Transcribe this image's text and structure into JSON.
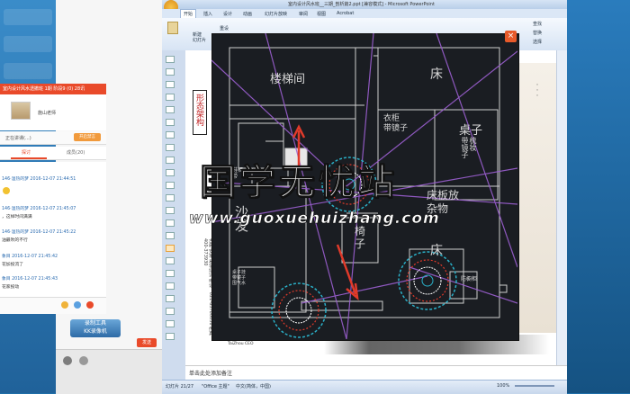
{
  "chat": {
    "title": "室内设计风水透撤班 1期  阶段9 (0) 28讯",
    "teacher": "施山老师",
    "status_text": "正在讲课(...)",
    "status_button": "开启禁言",
    "tabs": [
      "探讨",
      "成员(20)"
    ],
    "messages": [
      {
        "meta": "146·温热的梦 2016-12-07 21:44:51",
        "text": ""
      },
      {
        "meta": "146·温热的梦 2016-12-07 21:45:07",
        "text": "，这样时间满满"
      },
      {
        "meta": "146·温热的梦 2016-12-07 21:45:22",
        "text": "油最吹的不行"
      },
      {
        "meta": "象目 2016-12-07 21:45:42",
        "text": "花加投流了"
      },
      {
        "meta": "象目 2016-12-07 21:45:43",
        "text": "花家投动"
      }
    ],
    "recorder_line1": "录制工具",
    "recorder_line2": "KK录像机",
    "send_label": "发送"
  },
  "ppt": {
    "title": "室内设计风水班__三期_剖析篇2.ppt [兼容模式] - Microsoft PowerPoint",
    "ribbon_tabs": [
      "开始",
      "插入",
      "设计",
      "动画",
      "幻灯片放映",
      "审阅",
      "视图",
      "Acrobat"
    ],
    "ribbon_new_slide": "新建\n幻灯片",
    "ribbon_reset": "重设",
    "ribbon_find": "查找",
    "ribbon_replace": "替换",
    "ribbon_select": "选择",
    "slide_vertical_title": "形态架构",
    "slide_contact": "古典·安家 易学培训 电话：021-63780058 传真：400-373930",
    "slide_brand": "TaiZhou CEO",
    "notes_placeholder": "单击此处添加备注",
    "status_slide": "幻灯片 21/27",
    "status_theme": "\"Office 主题\"",
    "status_lang": "中文(简体，中国)",
    "status_zoom": "100%"
  },
  "cad": {
    "labels": {
      "stairwell": "楼梯间",
      "bed_top": "床",
      "cabinet": "衣柜\n带镜子",
      "table_right": "桌子",
      "mirror_cabinet": "梳妆\n带镜子",
      "shoe_cabinet": "鞋柜\n带",
      "sofa": "沙发",
      "clutter": "床板放\n杂物",
      "chair": "椅\n子",
      "bed_bottom": "床",
      "wardrobe_bottom": "防橱柜",
      "small_table": "桌子挂\n带镜子\n围气水"
    }
  },
  "watermark": {
    "chinese": "国学无忧站",
    "url": "www.guoxuehuizhang.com"
  },
  "colors": {
    "accent_red": "#e94a2a",
    "ppt_blue": "#dbe7f6",
    "cad_bg": "#1a1d22"
  }
}
